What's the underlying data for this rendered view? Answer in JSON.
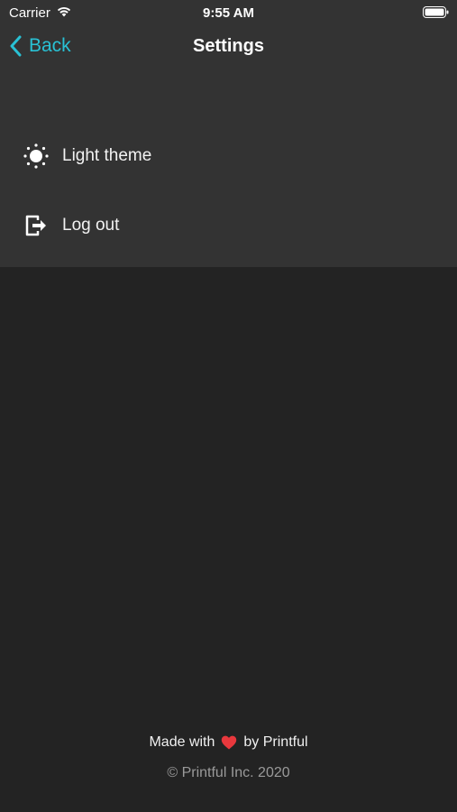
{
  "status_bar": {
    "carrier": "Carrier",
    "time": "9:55 AM"
  },
  "nav": {
    "back_label": "Back",
    "title": "Settings"
  },
  "menu": {
    "items": [
      {
        "label": "Light theme",
        "icon": "sun-icon"
      },
      {
        "label": "Log out",
        "icon": "logout-icon"
      }
    ]
  },
  "footer": {
    "made_with": "Made with",
    "by": "by Printful",
    "copyright": "© Printful Inc. 2020"
  },
  "colors": {
    "accent": "#29c1d4",
    "header_bg": "#333333",
    "body_bg": "#232323",
    "heart": "#e8383d"
  }
}
